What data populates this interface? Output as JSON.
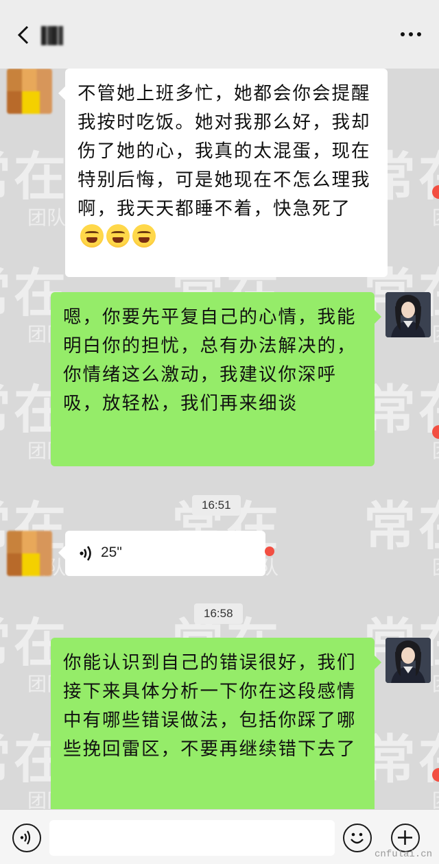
{
  "header": {
    "back_icon": "chevron-left-icon",
    "contact_name": "",
    "more_icon": "ellipsis-icon"
  },
  "messages": [
    {
      "side": "in",
      "text": "不管她上班多忙，她都会你会提醒我按时吃饭。她对我那么好，我却伤了她的心，我真的太混蛋，现在特别后悔，可是她现在不怎么理我啊，我天天都睡不着，快急死了",
      "emoji": [
        "grimace-emoji",
        "grimace-emoji",
        "grimace-emoji"
      ]
    },
    {
      "side": "out",
      "text": "嗯，你要先平复自己的心情，我能明白你的担忧，总有办法解决的，你情绪这么激动，我建议你深呼吸，放轻松，我们再来细谈"
    },
    {
      "type": "time",
      "text": "16:51"
    },
    {
      "side": "in",
      "type": "voice",
      "duration": "25\"",
      "unread": true
    },
    {
      "type": "time",
      "text": "16:58"
    },
    {
      "side": "out",
      "text": "你能认识到自己的错误很好，我们接下来具体分析一下你在这段感情中有哪些错误做法，包括你踩了哪些挽回雷区，不要再继续错下去了"
    }
  ],
  "watermark": {
    "big": "常在",
    "small": "团队"
  },
  "bottom_bar": {
    "voice_icon": "voice-input-icon",
    "emoji_icon": "smiley-icon",
    "plus_icon": "plus-icon",
    "input_value": ""
  },
  "footer": "cnfulai.cn",
  "colors": {
    "out_bubble": "#95ec69",
    "in_bubble": "#ffffff",
    "background": "#d9d9d9",
    "unread_dot": "#f24f42"
  }
}
